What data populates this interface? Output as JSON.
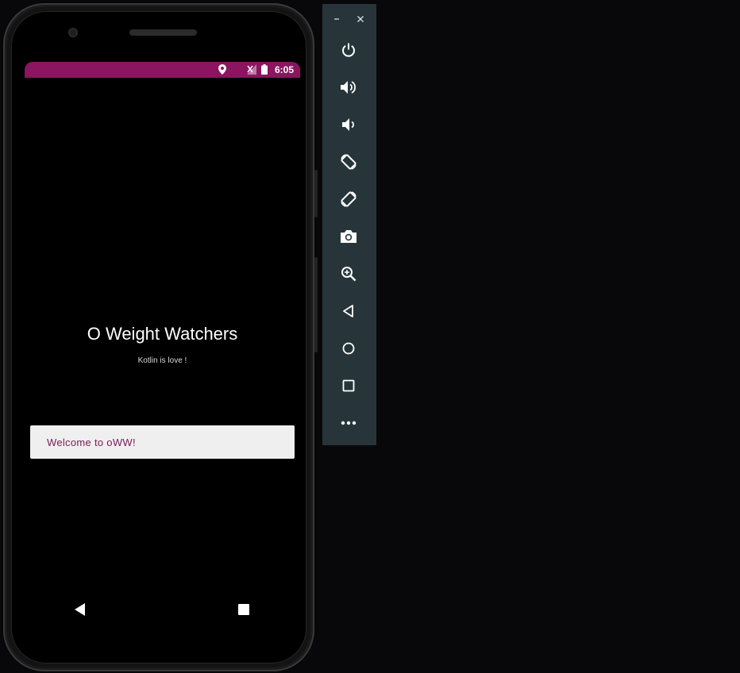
{
  "status_bar": {
    "time": "6:05",
    "icons": [
      "location-icon",
      "no-signal-icon",
      "battery-icon"
    ],
    "color": "#8b1560"
  },
  "app": {
    "title": "O Weight Watchers",
    "subtitle": "Kotlin is love !",
    "welcome_button_label": "Welcome to oWW!",
    "accent_color": "#7a1a5a"
  },
  "nav_bar": {
    "buttons": [
      "back-icon",
      "recents-icon"
    ]
  },
  "emulator_toolbar": {
    "window_controls": [
      "minimize-icon",
      "close-icon"
    ],
    "tools": [
      "power-icon",
      "volume-up-icon",
      "volume-down-icon",
      "rotate-left-icon",
      "rotate-right-icon",
      "camera-icon",
      "zoom-icon",
      "back-icon",
      "home-icon",
      "overview-icon",
      "more-icon"
    ],
    "background": "#27353b"
  }
}
